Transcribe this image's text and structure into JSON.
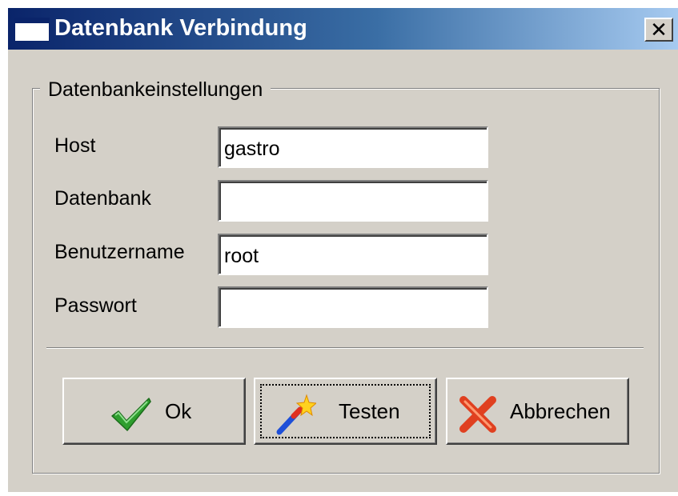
{
  "window": {
    "title": "Datenbank Verbindung",
    "close_label": "✕"
  },
  "group": {
    "legend": "Datenbankeinstellungen"
  },
  "fields": [
    {
      "label": "Host",
      "value": "gastro"
    },
    {
      "label": "Datenbank",
      "value": ""
    },
    {
      "label": "Benutzername",
      "value": "root"
    },
    {
      "label": "Passwort",
      "value": ""
    }
  ],
  "buttons": {
    "ok": {
      "label": "Ok",
      "icon": "checkmark-icon",
      "color": "#2e9e2e"
    },
    "test": {
      "label": "Testen",
      "icon": "magic-wand-icon",
      "color": "#1e4fd8"
    },
    "cancel": {
      "label": "Abbrechen",
      "icon": "red-x-icon",
      "color": "#e04020"
    }
  }
}
